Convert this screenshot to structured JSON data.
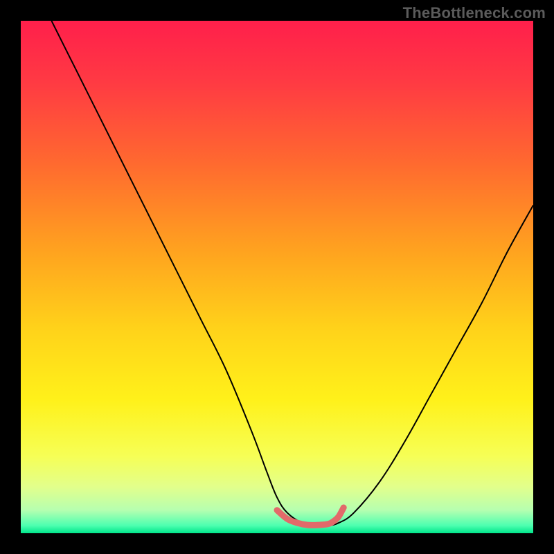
{
  "watermark": "TheBottleneck.com",
  "chart_data": {
    "type": "line",
    "title": "",
    "xlabel": "",
    "ylabel": "",
    "xlim": [
      0,
      100
    ],
    "ylim": [
      0,
      100
    ],
    "background_gradient": {
      "stops": [
        {
          "pos": 0.0,
          "color": "#ff1f4b"
        },
        {
          "pos": 0.12,
          "color": "#ff3a43"
        },
        {
          "pos": 0.28,
          "color": "#ff6a2f"
        },
        {
          "pos": 0.45,
          "color": "#ffa31f"
        },
        {
          "pos": 0.6,
          "color": "#ffd21a"
        },
        {
          "pos": 0.74,
          "color": "#fff11a"
        },
        {
          "pos": 0.85,
          "color": "#f6ff56"
        },
        {
          "pos": 0.91,
          "color": "#e2ff8c"
        },
        {
          "pos": 0.955,
          "color": "#b6ffb0"
        },
        {
          "pos": 0.985,
          "color": "#4dffb0"
        },
        {
          "pos": 1.0,
          "color": "#00e58a"
        }
      ]
    },
    "series": [
      {
        "name": "bottleneck-curve",
        "stroke": "#000000",
        "stroke_width": 2,
        "x": [
          6,
          10,
          15,
          20,
          25,
          30,
          35,
          40,
          45,
          48,
          50,
          52,
          55,
          58,
          60,
          62,
          65,
          70,
          75,
          80,
          85,
          90,
          95,
          100
        ],
        "y": [
          100,
          92,
          82,
          72,
          62,
          52,
          42,
          32,
          20,
          12,
          7,
          4,
          2,
          1.5,
          1.5,
          2,
          4,
          10,
          18,
          27,
          36,
          45,
          55,
          64
        ]
      },
      {
        "name": "optimal-band",
        "stroke": "#e26a6a",
        "stroke_width": 9,
        "linecap": "round",
        "x": [
          50,
          52,
          54,
          56,
          58,
          60,
          61,
          62,
          63
        ],
        "y": [
          4.5,
          2.8,
          2.0,
          1.6,
          1.6,
          1.8,
          2.3,
          3.2,
          5.0
        ]
      }
    ]
  }
}
